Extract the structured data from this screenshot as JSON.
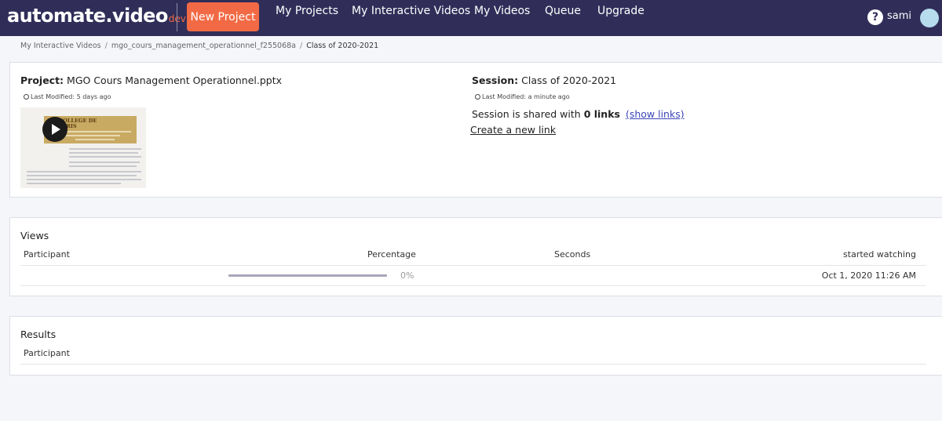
{
  "brand": {
    "name": "automate.video",
    "suffix": "dev"
  },
  "nav": {
    "new_project": "New Project",
    "links": [
      "My Projects",
      "My Interactive Videos",
      "My Videos",
      "Queue",
      "Upgrade"
    ],
    "help_symbol": "?",
    "user": "sami",
    "help_icon": "question-circle-icon"
  },
  "breadcrumb": [
    "My Interactive Videos",
    "mgo_cours_management_operationnel_f255068a",
    "Class of 2020-2021"
  ],
  "project": {
    "label": "Project:",
    "name": "MGO Cours Management Operationnel.pptx",
    "last_modified": "Last Modified: 5 days ago",
    "thumbnail_title": "COLLEGE DE PARIS"
  },
  "session": {
    "label": "Session:",
    "name": "Class of 2020-2021",
    "last_modified": "Last Modified: a minute ago",
    "shared_prefix": "Session is shared with",
    "shared_count": "0 links",
    "show_links": "(show links)",
    "create_link": "Create a new link"
  },
  "views": {
    "title": "Views",
    "columns": [
      "Participant",
      "Percentage",
      "Seconds",
      "started watching"
    ],
    "rows": [
      {
        "participant": "",
        "percentage": "0%",
        "progress_fraction": 0,
        "seconds": "",
        "started": "Oct 1, 2020 11:26 AM"
      }
    ]
  },
  "results": {
    "title": "Results",
    "columns": [
      "Participant"
    ]
  },
  "colors": {
    "nav_bg": "#302e59",
    "accent": "#f26a45",
    "link": "#3b45b8",
    "avatar": "#b6dcee"
  }
}
